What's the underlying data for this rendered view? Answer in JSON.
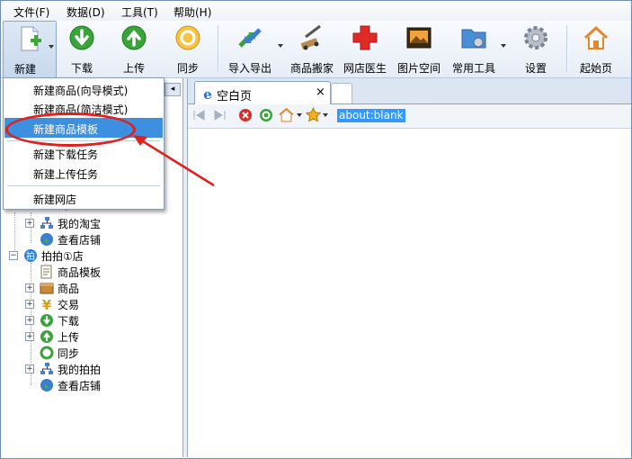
{
  "menubar": {
    "items": [
      "文件(F)",
      "数据(D)",
      "工具(T)",
      "帮助(H)"
    ]
  },
  "toolbar": {
    "buttons": [
      {
        "label": "新建",
        "icon": "new-document-icon"
      },
      {
        "label": "下载",
        "icon": "download-arrow-icon"
      },
      {
        "label": "上传",
        "icon": "upload-arrow-icon"
      },
      {
        "label": "同步",
        "icon": "sync-icon"
      },
      {
        "label": "导入导出",
        "icon": "import-export-icon"
      },
      {
        "label": "商品搬家",
        "icon": "product-move-icon"
      },
      {
        "label": "网店医生",
        "icon": "red-cross-icon"
      },
      {
        "label": "图片空间",
        "icon": "image-space-icon"
      },
      {
        "label": "常用工具",
        "icon": "tools-folder-icon"
      },
      {
        "label": "设置",
        "icon": "gear-icon"
      },
      {
        "label": "起始页",
        "icon": "home-icon"
      }
    ]
  },
  "dropdown": {
    "items": [
      "新建商品(向导模式)",
      "新建商品(简洁模式)",
      "新建商品模板",
      "新建下载任务",
      "新建上传任务",
      "新建网店"
    ],
    "highlighted_index": 2
  },
  "tree": {
    "partial_top": "同步",
    "taobao_items": [
      "我的淘宝",
      "查看店铺"
    ],
    "shop_root": "拍拍①店",
    "shop_children": [
      "商品模板",
      "商品",
      "交易",
      "下载",
      "上传",
      "同步",
      "我的拍拍",
      "查看店铺"
    ]
  },
  "browser": {
    "tab_title": "空白页",
    "close_glyph": "×",
    "url": "about:blank"
  },
  "colors": {
    "highlight": "#3d8fe0",
    "annotation": "#e0201e"
  }
}
